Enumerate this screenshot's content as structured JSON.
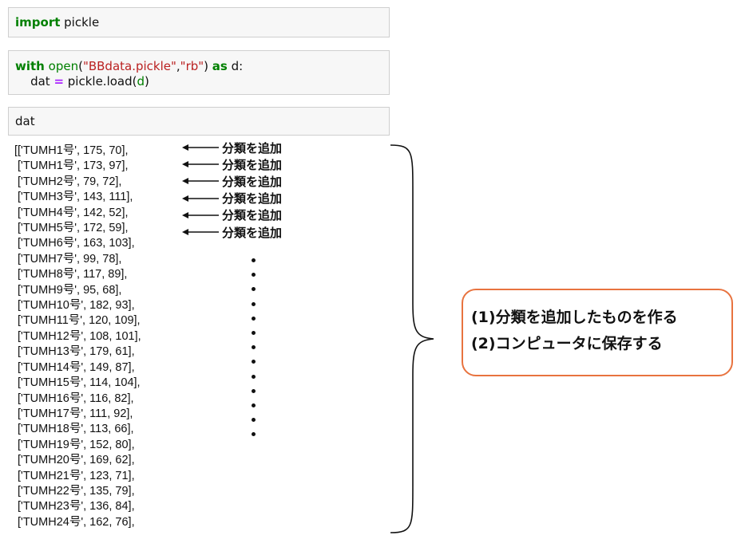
{
  "cells": [
    {
      "id": "cell1",
      "lines": [
        [
          {
            "t": "import",
            "c": "kw"
          },
          {
            "t": " pickle",
            "c": "pr"
          }
        ]
      ]
    },
    {
      "id": "cell2",
      "lines": [
        [
          {
            "t": "with",
            "c": "kw"
          },
          {
            "t": " ",
            "c": "pr"
          },
          {
            "t": "open",
            "c": "bi"
          },
          {
            "t": "(",
            "c": "pr"
          },
          {
            "t": "\"BBdata.pickle\"",
            "c": "str"
          },
          {
            "t": ",",
            "c": "pr"
          },
          {
            "t": "\"rb\"",
            "c": "str"
          },
          {
            "t": ") ",
            "c": "pr"
          },
          {
            "t": "as",
            "c": "kw"
          },
          {
            "t": " d:",
            "c": "pr"
          }
        ],
        [
          {
            "t": "    dat ",
            "c": "pr"
          },
          {
            "t": "=",
            "c": "op"
          },
          {
            "t": " pickle.load",
            "c": "pr"
          },
          {
            "t": "(",
            "c": "pr"
          },
          {
            "t": "d",
            "c": "bi"
          },
          {
            "t": ")",
            "c": "pr"
          }
        ]
      ]
    },
    {
      "id": "cell3",
      "lines": [
        [
          {
            "t": "dat",
            "c": "pr"
          }
        ]
      ]
    }
  ],
  "output_rows": [
    "[['TUMH1号', 175, 70],",
    " ['TUMH1号', 173, 97],",
    " ['TUMH2号', 79, 72],",
    " ['TUMH3号', 143, 111],",
    " ['TUMH4号', 142, 52],",
    " ['TUMH5号', 172, 59],",
    " ['TUMH6号', 163, 103],",
    " ['TUMH7号', 99, 78],",
    " ['TUMH8号', 117, 89],",
    " ['TUMH9号', 95, 68],",
    " ['TUMH10号', 182, 93],",
    " ['TUMH11号', 120, 109],",
    " ['TUMH12号', 108, 101],",
    " ['TUMH13号', 179, 61],",
    " ['TUMH14号', 149, 87],",
    " ['TUMH15号', 114, 104],",
    " ['TUMH16号', 116, 82],",
    " ['TUMH17号', 111, 92],",
    " ['TUMH18号', 113, 66],",
    " ['TUMH19号', 152, 80],",
    " ['TUMH20号', 169, 62],",
    " ['TUMH21号', 123, 71],",
    " ['TUMH22号', 135, 79],",
    " ['TUMH23号', 136, 84],",
    " ['TUMH24号', 162, 76],"
  ],
  "annotations": {
    "arrow_label": "分類を追加",
    "arrow_count": 6,
    "dot_count": 13
  },
  "callout": {
    "line1": "(1)分類を追加したものを作る",
    "line2": "(2)コンピュータに保存する",
    "border_color": "#e8733f"
  }
}
